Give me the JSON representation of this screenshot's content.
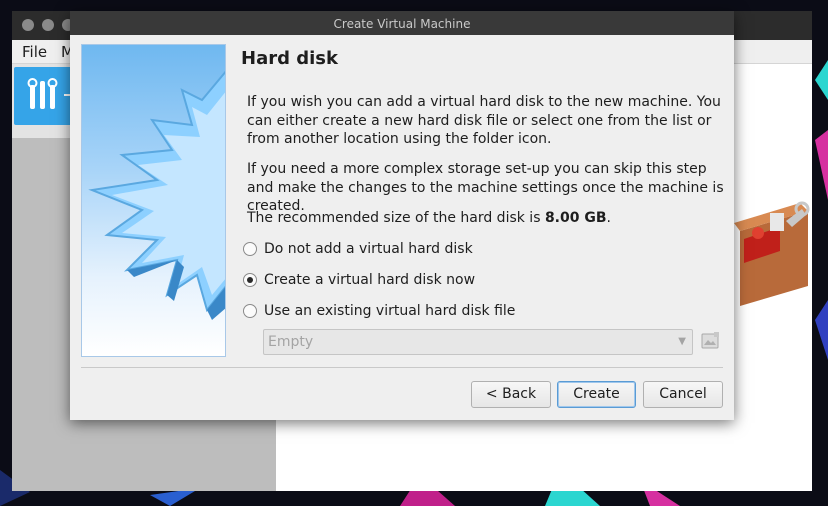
{
  "main_window": {
    "menu": [
      "File",
      "M"
    ]
  },
  "dialog": {
    "title": "Create Virtual Machine",
    "page_title": "Hard disk",
    "paragraph1": "If you wish you can add a virtual hard disk to the new machine. You can either create a new hard disk file or select one from the list or from another location using the folder icon.",
    "paragraph2": "If you need a more complex storage set-up you can skip this step and make the changes to the machine settings once the machine is created.",
    "recommended_prefix": "The recommended size of the hard disk is ",
    "recommended_size": "8.00 GB",
    "recommended_suffix": ".",
    "options": [
      {
        "label": "Do not add a virtual hard disk",
        "checked": false
      },
      {
        "label": "Create a virtual hard disk now",
        "checked": true
      },
      {
        "label": "Use an existing virtual hard disk file",
        "checked": false
      }
    ],
    "disk_combo": {
      "value": "Empty",
      "enabled": false
    },
    "buttons": {
      "back": "< Back",
      "create": "Create",
      "cancel": "Cancel"
    }
  },
  "colors": {
    "accent": "#35a4e8",
    "dialog_bg": "#efefef",
    "titlebar": "#393939"
  },
  "icons": [
    "tools-icon",
    "radio-icon",
    "chevron-down-icon",
    "folder-icon",
    "toolbox-icon",
    "starburst-image"
  ]
}
